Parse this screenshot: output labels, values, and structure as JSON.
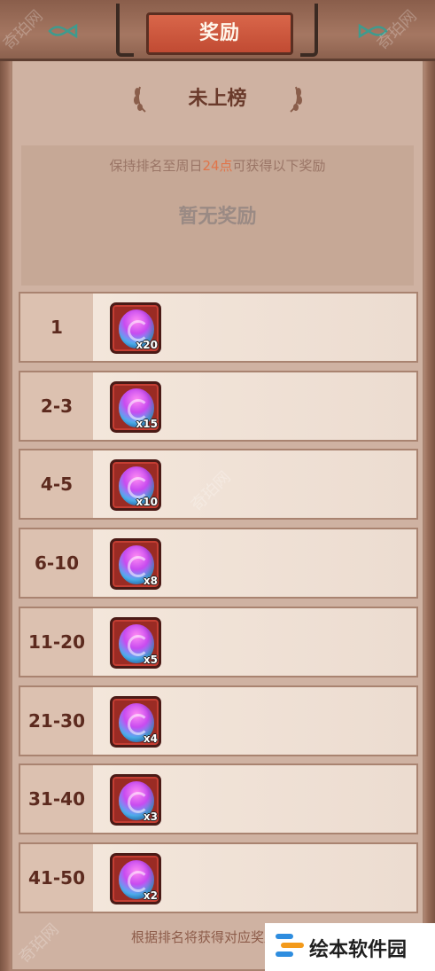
{
  "header": {
    "title": "奖励"
  },
  "status": {
    "rank_text": "未上榜"
  },
  "notice": {
    "prefix": "保持排名至周日",
    "highlight": "24点",
    "suffix": "可获得以下奖励",
    "empty_text": "暂无奖励"
  },
  "rewards": [
    {
      "rank": "1",
      "qty": "x20"
    },
    {
      "rank": "2-3",
      "qty": "x15"
    },
    {
      "rank": "4-5",
      "qty": "x10"
    },
    {
      "rank": "6-10",
      "qty": "x8"
    },
    {
      "rank": "11-20",
      "qty": "x5"
    },
    {
      "rank": "21-30",
      "qty": "x4"
    },
    {
      "rank": "31-40",
      "qty": "x3"
    },
    {
      "rank": "41-50",
      "qty": "x2"
    }
  ],
  "footer": {
    "note": "根据排名将获得对应奖励（奖"
  },
  "watermark": {
    "text": "奇珀网"
  },
  "logo": {
    "text": "绘本软件园"
  },
  "colors": {
    "accent": "#c14b33",
    "highlight": "#e0754a",
    "gem": "#c84bf0"
  }
}
